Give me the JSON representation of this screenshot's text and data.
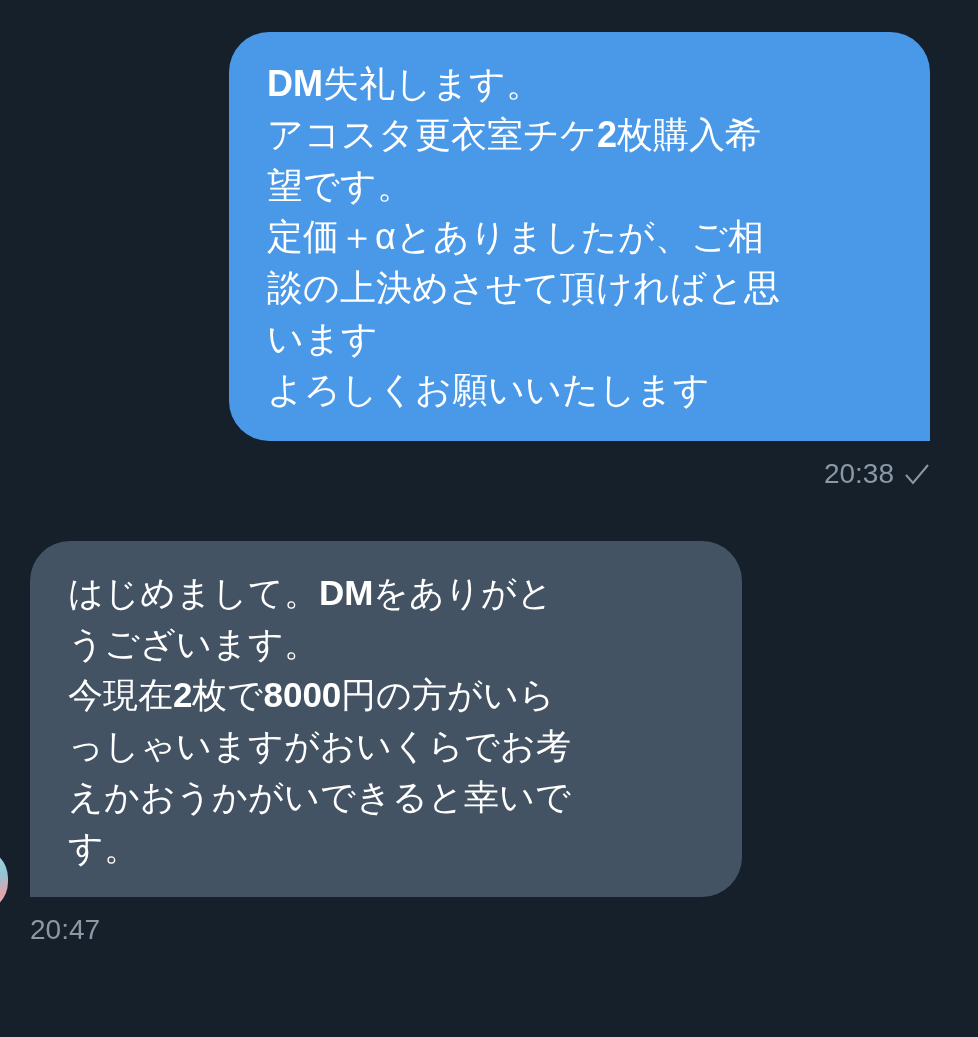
{
  "messages": [
    {
      "kind": "sent",
      "lines": [
        "**DM**失礼します。",
        "アコスタ更衣室チケ**2**枚購入希",
        "望です。",
        "定価＋αとありましたが、ご相",
        "談の上決めさせて頂ければと思",
        "います",
        "よろしくお願いいたします"
      ],
      "time": "20:38",
      "read": true
    },
    {
      "kind": "received",
      "lines": [
        "はじめまして。**DM**をありがと",
        "うございます。",
        "今現在**2**枚で**8000**円の方がいら",
        "っしゃいますがおいくらでお考",
        "えかおうかがいできると幸いで",
        "す。"
      ],
      "time": "20:47"
    }
  ]
}
